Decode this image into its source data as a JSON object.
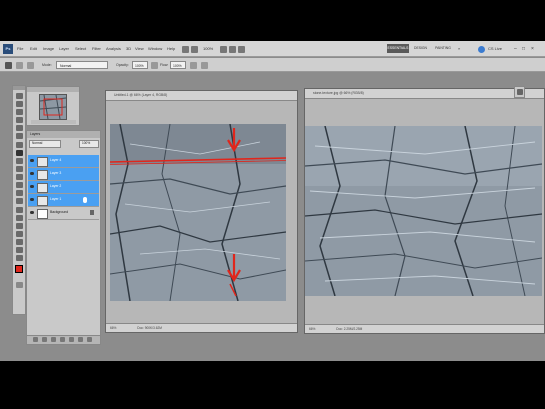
{
  "menu": {
    "logo": "Ps",
    "items": [
      "File",
      "Edit",
      "Image",
      "Layer",
      "Select",
      "Filter",
      "Analysis",
      "3D",
      "View",
      "Window",
      "Help"
    ],
    "zoom": "100%",
    "workspaces": [
      "ESSENTIALS",
      "DESIGN",
      "PAINTING"
    ],
    "cs_live": "CS Live"
  },
  "options": {
    "mode_label": "Mode:",
    "mode_value": "Normal",
    "opacity_label": "Opacity:",
    "opacity_value": "100%",
    "flow_label": "Flow:",
    "flow_value": "100%"
  },
  "layers_panel": {
    "tab": "Layers",
    "blend": "Normal",
    "opacity": "100%",
    "layers": [
      {
        "name": "Layer 4",
        "selected": true
      },
      {
        "name": "Layer 3",
        "selected": true
      },
      {
        "name": "Layer 2",
        "selected": true
      },
      {
        "name": "Layer 1",
        "selected": true
      },
      {
        "name": "Background",
        "selected": false
      }
    ]
  },
  "documents": [
    {
      "title": "Untitled-1 @ 66% (Layer 4, RGB/8)",
      "zoom": "66%",
      "status": "Doc: 900K/3.62M"
    },
    {
      "title": "stone-texture.jpg @ 66% (RGB/8)",
      "zoom": "66%",
      "status": "Doc: 2.25M/2.25M"
    }
  ],
  "colors": {
    "selection_blue": "#4aa0f2",
    "arrow_red": "#e0261c",
    "rock_light": "#c9d3dc",
    "rock_dark": "#3f4a55"
  }
}
